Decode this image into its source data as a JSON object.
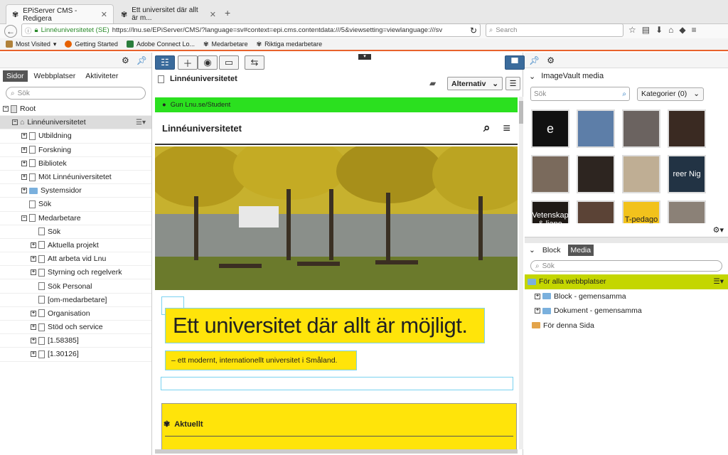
{
  "browser": {
    "tabs": [
      {
        "title": "EPiServer CMS - Redigera",
        "close": "✕"
      },
      {
        "title": "Ett universitet där allt är m...",
        "close": "✕"
      }
    ],
    "new_tab": "+",
    "url_site": "Linnéuniversitetet (SE)",
    "url": "https://lnu.se/EPiServer/CMS/?language=sv#context=epi.cms.contentdata:///5&viewsetting=viewlanguage:///sv",
    "search_placeholder": "Search",
    "bookmarks": [
      {
        "label": "Most Visited",
        "color": "#b0813a"
      },
      {
        "label": "Getting Started",
        "color": "#e66000"
      },
      {
        "label": "Adobe Connect Lo...",
        "color": "#2a7d3c"
      },
      {
        "label": "Medarbetare",
        "color": "#444444"
      },
      {
        "label": "Riktiga medarbetare",
        "color": "#444444"
      }
    ]
  },
  "left_panel": {
    "tabs": [
      "Sidor",
      "Webbplatser",
      "Aktiviteter"
    ],
    "search_placeholder": "Sök",
    "tree": [
      {
        "label": "Root",
        "level": 0,
        "expand": "−",
        "icon": "root-icon"
      },
      {
        "label": "Linnéuniversitetet",
        "level": 1,
        "expand": "−",
        "icon": "home-icon",
        "selected": true
      },
      {
        "label": "Utbildning",
        "level": 2,
        "expand": "+",
        "icon": "page-icon"
      },
      {
        "label": "Forskning",
        "level": 2,
        "expand": "+",
        "icon": "page-icon"
      },
      {
        "label": "Bibliotek",
        "level": 2,
        "expand": "+",
        "icon": "page-icon"
      },
      {
        "label": "Möt Linnéuniversitetet",
        "level": 2,
        "expand": "+",
        "icon": "page-icon"
      },
      {
        "label": "Systemsidor",
        "level": 2,
        "expand": "+",
        "icon": "folder-icon"
      },
      {
        "label": "Sök",
        "level": 2,
        "expand": "",
        "icon": "page-icon"
      },
      {
        "label": "Medarbetare",
        "level": 2,
        "expand": "−",
        "icon": "page-icon"
      },
      {
        "label": "Sök",
        "level": 3,
        "expand": "",
        "icon": "page-icon"
      },
      {
        "label": "Aktuella projekt",
        "level": 3,
        "expand": "+",
        "icon": "page-icon"
      },
      {
        "label": "Att arbeta vid Lnu",
        "level": 3,
        "expand": "+",
        "icon": "page-icon"
      },
      {
        "label": "Styrning och regelverk",
        "level": 3,
        "expand": "+",
        "icon": "page-icon"
      },
      {
        "label": "Sök Personal",
        "level": 3,
        "expand": "",
        "icon": "page-icon"
      },
      {
        "label": "[om-medarbetare]",
        "level": 3,
        "expand": "",
        "icon": "page-icon"
      },
      {
        "label": "Organisation",
        "level": 3,
        "expand": "+",
        "icon": "page-icon"
      },
      {
        "label": "Stöd och service",
        "level": 3,
        "expand": "+",
        "icon": "page-icon"
      },
      {
        "label": "[1.58385]",
        "level": 3,
        "expand": "+",
        "icon": "page-icon"
      },
      {
        "label": "[1.30126]",
        "level": 3,
        "expand": "+",
        "icon": "page-icon"
      }
    ]
  },
  "center": {
    "page_title": "Linnéuniversitetet",
    "options_label": "Alternativ",
    "user_bar": "Gun Lnu.se/Student",
    "site_name": "Linnéuniversitetet",
    "headline": "Ett universitet där allt är möjligt.",
    "subline": "– ett modernt, internationellt universitet i Småland.",
    "news_title": "Aktuellt"
  },
  "right_panel": {
    "imagevault_title": "ImageVault media",
    "search_placeholder": "Sök",
    "categories_label": "Kategorier (0)",
    "thumbs": [
      {
        "name": "logo-e",
        "color": "#111111",
        "text": "e"
      },
      {
        "name": "campus-sky",
        "color": "#5d7ea8",
        "text": ""
      },
      {
        "name": "group-photo",
        "color": "#6b6360",
        "text": ""
      },
      {
        "name": "concert",
        "color": "#3a2a22",
        "text": ""
      },
      {
        "name": "portrait-woman",
        "color": "#7a6a5c",
        "text": ""
      },
      {
        "name": "lamp",
        "color": "#2d2520",
        "text": ""
      },
      {
        "name": "manuscript",
        "color": "#bfae94",
        "text": ""
      },
      {
        "name": "career-night",
        "color": "#223344",
        "text": "reer Nig"
      },
      {
        "name": "vetenskap",
        "color": "#1f1a16",
        "text": "Vetenskap & liane"
      },
      {
        "name": "audience",
        "color": "#5b4336",
        "text": ""
      },
      {
        "name": "t-pedago",
        "color": "#f2c21c",
        "text": "T-pedago"
      },
      {
        "name": "portrait-man",
        "color": "#8b8177",
        "text": ""
      }
    ],
    "block_tabs": [
      "Block",
      "Media"
    ],
    "block_search_placeholder": "Sök",
    "media_tree": [
      {
        "label": "För alla webbplatser",
        "expand": "",
        "icon": "folder-icon",
        "selected": true
      },
      {
        "label": "Block - gemensamma",
        "expand": "+",
        "icon": "folder-icon"
      },
      {
        "label": "Dokument - gemensamma",
        "expand": "+",
        "icon": "folder-icon"
      },
      {
        "label": "För denna Sida",
        "expand": "",
        "icon": "folder-icon"
      }
    ]
  },
  "colors": {
    "accent_green": "#2be01f",
    "yellow": "#ffe40a",
    "lime_selected": "#c4d600",
    "firefox_orange": "#e8622c",
    "toolbar_blue": "#3a6b9c"
  }
}
